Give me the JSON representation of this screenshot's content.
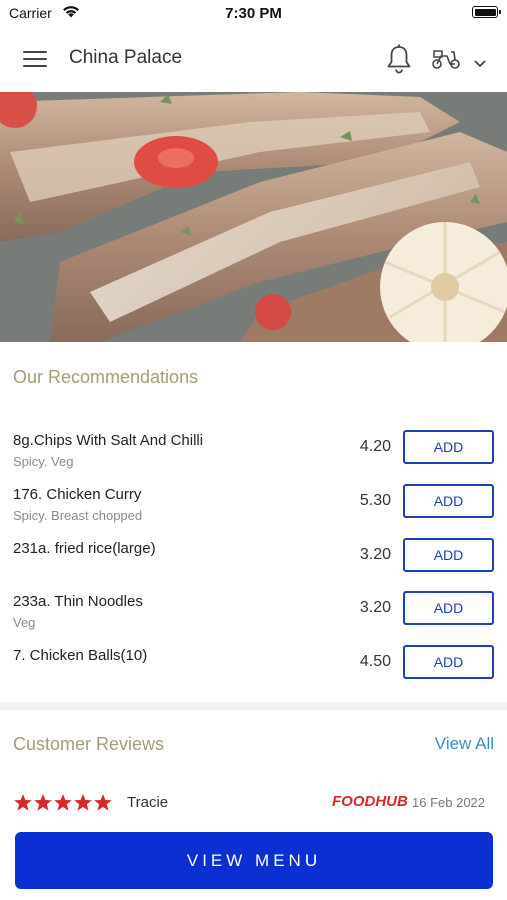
{
  "status_bar": {
    "carrier": "Carrier",
    "time": "7:30 PM"
  },
  "header": {
    "restaurant_name": "China Palace",
    "icons": [
      "menu-icon",
      "bell-icon",
      "delivery-scooter-icon",
      "chevron-down-icon"
    ]
  },
  "hero": {
    "image": "grilled lamb ribs with chili and garlic"
  },
  "recommendations": {
    "title": "Our Recommendations",
    "add_label": "ADD",
    "items": [
      {
        "name": "8g.Chips With Salt And Chilli",
        "description": "Spicy. Veg",
        "price": "4.20"
      },
      {
        "name": "176. Chicken Curry",
        "description": "Spicy. Breast chopped",
        "price": "5.30"
      },
      {
        "name": "231a. fried rice(large)",
        "description": "",
        "price": "3.20"
      },
      {
        "name": "233a. Thin Noodles",
        "description": "Veg",
        "price": "3.20"
      },
      {
        "name": "7. Chicken Balls(10)",
        "description": "",
        "price": "4.50"
      }
    ]
  },
  "reviews": {
    "title": "Customer Reviews",
    "view_all": "View All",
    "items": [
      {
        "rating": 5,
        "reviewer": "Tracie",
        "source": "FOODHUB",
        "date": "16 Feb 2022"
      }
    ]
  },
  "footer": {
    "view_menu_label": "VIEW MENU"
  },
  "colors": {
    "accent_gold": "#a69c77",
    "brand_blue": "#0b2fd0",
    "add_button_blue": "#1d3fb8",
    "link_blue": "#3b8eb8",
    "star_red": "#d42a2a"
  }
}
